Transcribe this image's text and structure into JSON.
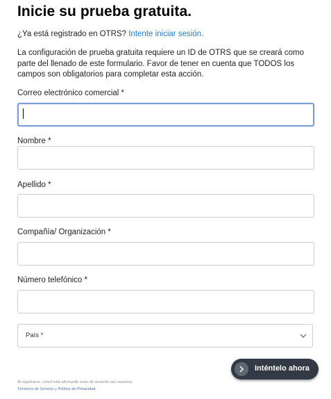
{
  "header": {
    "title": "Inicie su prueba gratuita."
  },
  "login_prompt": {
    "text": "¿Ya está registrado en OTRS? ",
    "link_label": "Intente iniciar sesión."
  },
  "intro": {
    "text": "La configuración de prueba gratuita requiere un ID de OTRS que se creará como parte del llenado de este formulario. Favor de tener en cuenta que TODOS los campos son obligatorios para completar esta acción."
  },
  "form": {
    "email_label": "Correo electrónico comercial *",
    "email_value": "",
    "first_name_label": "Nombre *",
    "first_name_value": "",
    "last_name_label": "Apellido *",
    "last_name_value": "",
    "company_label": "Compañía/ Organización *",
    "company_value": "",
    "phone_label": "Número telefónico *",
    "phone_value": "",
    "country_selected": "País *",
    "submit_label": "Inténtelo ahora"
  },
  "legal": {
    "line1": "Al registrarse, usted está afirmando estar de acuerdo con nuestros",
    "terms_link": "Términos de Servicio y Política de Privacidad",
    "terms_suffix": "."
  },
  "colors": {
    "link": "#2a7ab9",
    "button_bg": "#313a45",
    "focus_border": "#7a9ed6"
  },
  "icons": {
    "submit": "chevron-right-icon",
    "select": "chevron-down-icon"
  }
}
